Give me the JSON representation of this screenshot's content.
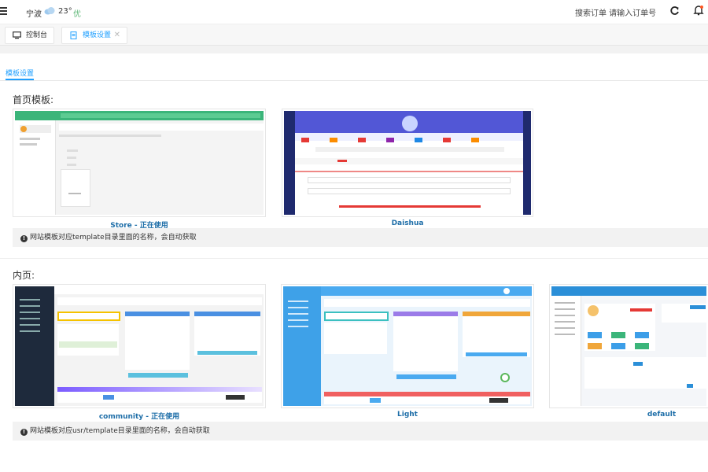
{
  "header": {
    "city": "宁波",
    "temperature": "23°",
    "air_quality": "优",
    "search_label": "搜索订单 请输入订单号"
  },
  "tabs": [
    {
      "label": "控制台"
    },
    {
      "label": "模板设置"
    }
  ],
  "subtab": "模板设置",
  "home_section": {
    "title": "首页模板:",
    "templates": [
      {
        "label": "Store - 正在使用"
      },
      {
        "label": "Daishua"
      }
    ],
    "notice": "网站模板对应template目录里面的名称，会自动获取"
  },
  "inner_section": {
    "title": "内页:",
    "templates": [
      {
        "label": "community - 正在使用"
      },
      {
        "label": "Light"
      },
      {
        "label": "default"
      }
    ],
    "notice": "网站模板对应usr/template目录里面的名称，会自动获取"
  },
  "colors": {
    "accent": "#1e9fff",
    "label": "#1e6ea8",
    "good": "#5fb878"
  }
}
